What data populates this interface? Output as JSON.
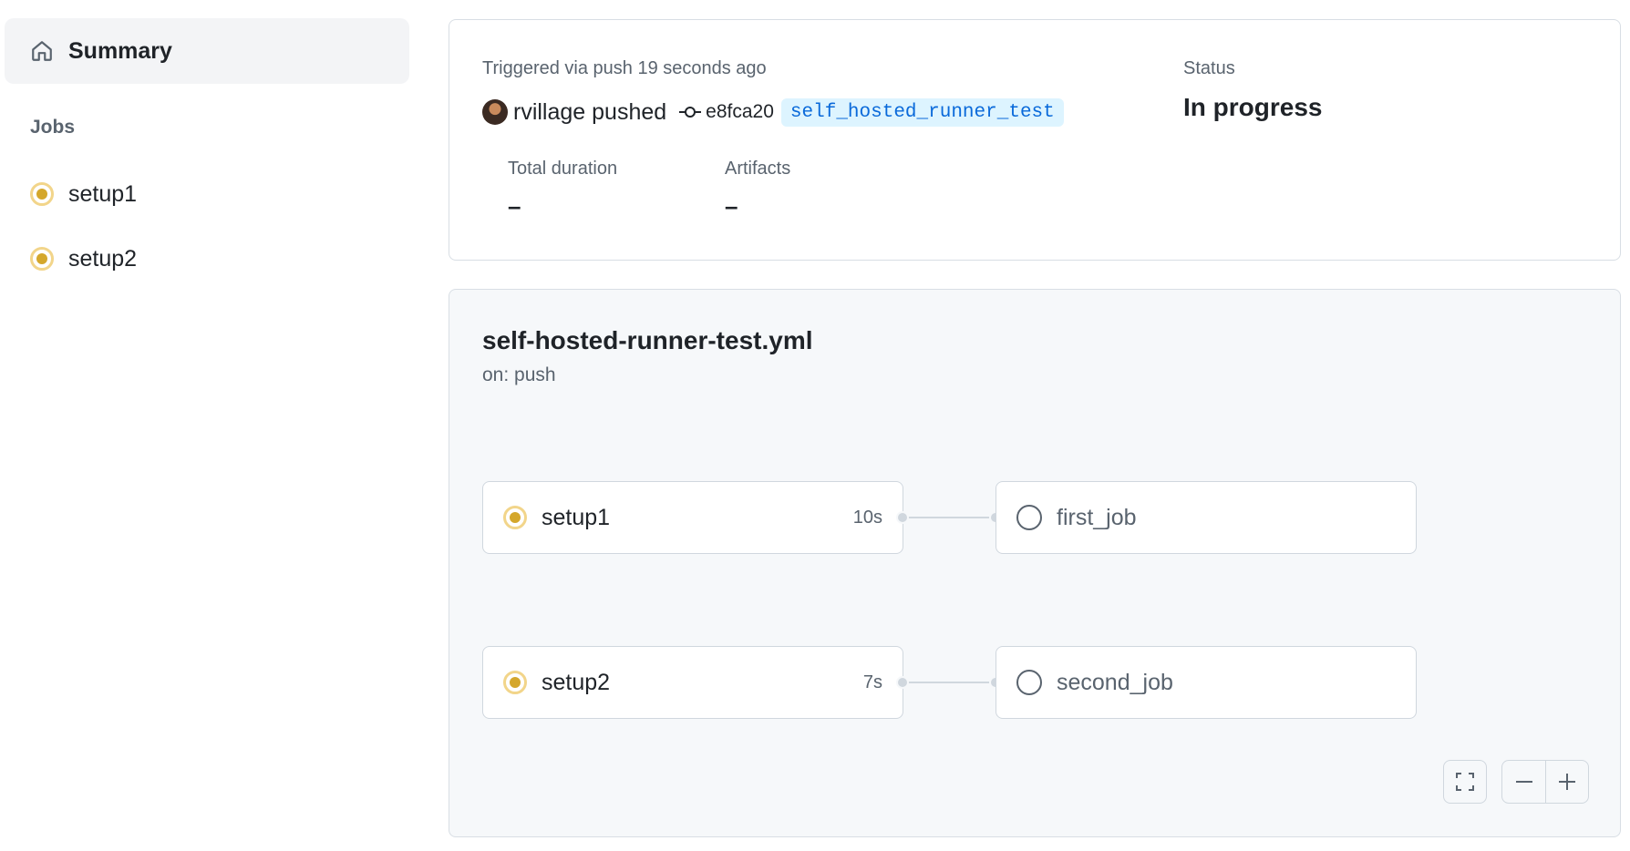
{
  "sidebar": {
    "summary_label": "Summary",
    "jobs_heading": "Jobs",
    "jobs": [
      {
        "label": "setup1",
        "status": "in-progress"
      },
      {
        "label": "setup2",
        "status": "in-progress"
      }
    ]
  },
  "run": {
    "triggered": "Triggered via push 19 seconds ago",
    "pusher": "rvillage pushed",
    "sha": "e8fca20",
    "branch": "self_hosted_runner_test",
    "status_label": "Status",
    "status_value": "In progress",
    "duration_label": "Total duration",
    "duration_value": "–",
    "artifacts_label": "Artifacts",
    "artifacts_value": "–"
  },
  "workflow": {
    "name": "self-hosted-runner-test.yml",
    "on": "on: push",
    "jobs": [
      {
        "name": "setup1",
        "duration": "10s",
        "status": "in-progress"
      },
      {
        "name": "first_job",
        "status": "queued"
      },
      {
        "name": "setup2",
        "duration": "7s",
        "status": "in-progress"
      },
      {
        "name": "second_job",
        "status": "queued"
      }
    ]
  },
  "colors": {
    "in_progress": "#d4a72c",
    "branch_text": "#0969da",
    "branch_bg": "#ddf4ff"
  },
  "icons": {
    "summary": "home-icon",
    "commit": "git-commit-icon",
    "fullscreen": "fullscreen-icon",
    "zoom_out": "minus-icon",
    "zoom_in": "plus-icon"
  }
}
